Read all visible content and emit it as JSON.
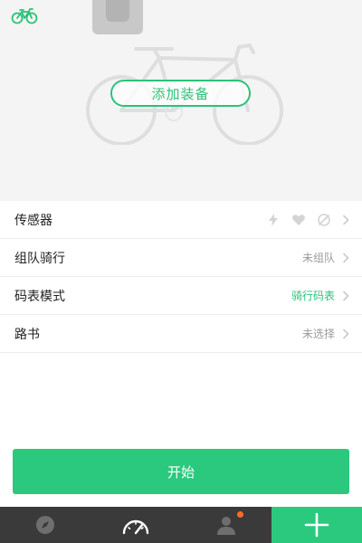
{
  "hero": {
    "top_icon": "bicycle-icon",
    "add_gear_label": "添加装备"
  },
  "settings": {
    "rows": [
      {
        "label": "传感器",
        "icons": [
          "lightning-icon",
          "heart-icon",
          "cadence-icon"
        ]
      },
      {
        "label": "组队骑行",
        "value": "未组队"
      },
      {
        "label": "码表模式",
        "value": "骑行码表",
        "value_color": "#2bc279"
      },
      {
        "label": "路书",
        "value": "未选择"
      }
    ]
  },
  "start_button": {
    "label": "开始"
  },
  "tabbar": {
    "tabs": [
      {
        "icon": "compass-icon"
      },
      {
        "icon": "speedometer-icon",
        "active": true
      },
      {
        "icon": "profile-icon",
        "badge": true
      },
      {
        "icon": "plus-icon"
      }
    ]
  },
  "colors": {
    "accent": "#2bc97d",
    "tabbar_background": "#3a3a3a",
    "badge": "#ff6a2a"
  }
}
